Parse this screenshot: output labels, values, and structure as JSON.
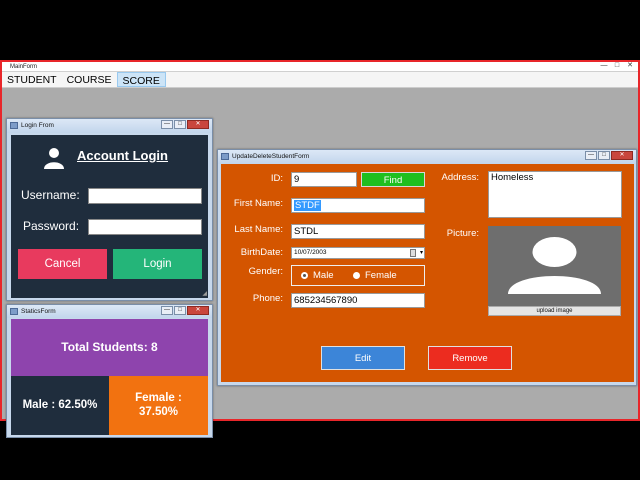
{
  "main_window": {
    "title": "MainForm"
  },
  "menu": [
    {
      "label": "STUDENT",
      "active": false
    },
    {
      "label": "COURSE",
      "active": false
    },
    {
      "label": "SCORE",
      "active": true
    }
  ],
  "window_buttons": {
    "minimize": "—",
    "maximize": "□",
    "close": "✕"
  },
  "login_form": {
    "title": "Login From",
    "heading": "Account Login",
    "username_label": "Username:",
    "username_value": "",
    "password_label": "Password:",
    "password_value": "",
    "cancel_label": "Cancel",
    "login_label": "Login",
    "colors": {
      "panel": "#1f2d3d",
      "cancel": "#e83a5e",
      "login": "#24b579"
    }
  },
  "statics_form": {
    "title": "StaticsForm",
    "total_text": "Total Students: 8",
    "male_text": "Male : 62.50%",
    "female_line1": "Female :",
    "female_line2": "37.50%",
    "colors": {
      "total": "#8e44ad",
      "male": "#1f2d3d",
      "female": "#f27210"
    }
  },
  "update_form": {
    "title": "UpdateDeleteStudentForm",
    "id_label": "ID:",
    "id_value": "9",
    "find_label": "Find",
    "first_name_label": "First Name:",
    "first_name_value": "STDF",
    "last_name_label": "Last Name:",
    "last_name_value": "STDL",
    "birthdate_label": "BirthDate:",
    "birthdate_value": "10/07/2003",
    "gender_label": "Gender:",
    "gender_options": [
      "Male",
      "Female"
    ],
    "gender_selected": "Male",
    "phone_label": "Phone:",
    "phone_value": "685234567890",
    "address_label": "Address:",
    "address_value": "Homeless",
    "picture_label": "Picture:",
    "upload_label": "upload image",
    "edit_label": "Edit",
    "remove_label": "Remove",
    "colors": {
      "panel": "#d45500",
      "find": "#1fbf1f",
      "edit": "#3c85d8",
      "remove": "#ec2c1f"
    }
  }
}
